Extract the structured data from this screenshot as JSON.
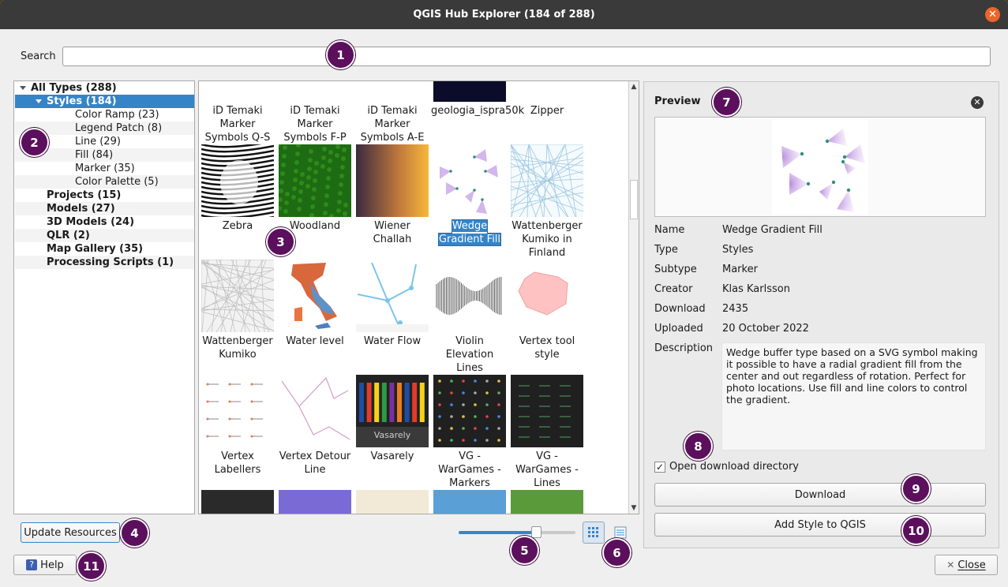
{
  "window": {
    "title": "QGIS Hub Explorer (184 of 288)",
    "close_glyph": "✕"
  },
  "search": {
    "label": "Search",
    "value": "",
    "placeholder": ""
  },
  "tree": {
    "items": [
      {
        "label": "All Types (288)",
        "level": 0,
        "bold": true,
        "expanded": true
      },
      {
        "label": "Styles (184)",
        "level": 1,
        "bold": true,
        "expanded": true,
        "selected": true
      },
      {
        "label": "Color Ramp (23)",
        "level": 2
      },
      {
        "label": "Legend Patch (8)",
        "level": 2
      },
      {
        "label": "Line (29)",
        "level": 2
      },
      {
        "label": "Fill (84)",
        "level": 2
      },
      {
        "label": "Marker (35)",
        "level": 2
      },
      {
        "label": "Color Palette (5)",
        "level": 2
      },
      {
        "label": "Projects (15)",
        "level": 1,
        "bold": true
      },
      {
        "label": "Models (27)",
        "level": 1,
        "bold": true
      },
      {
        "label": "3D Models (24)",
        "level": 1,
        "bold": true
      },
      {
        "label": "QLR (2)",
        "level": 1,
        "bold": true
      },
      {
        "label": "Map Gallery (35)",
        "level": 1,
        "bold": true
      },
      {
        "label": "Processing Scripts (1)",
        "level": 1,
        "bold": true
      }
    ]
  },
  "gallery": {
    "items": [
      {
        "label": "iD Temaki Marker Symbols Q-S",
        "thumb": "icon-grid-dark"
      },
      {
        "label": "iD Temaki Marker Symbols F-P",
        "thumb": "icon-grid-dark"
      },
      {
        "label": "iD Temaki Marker Symbols A-E",
        "thumb": "icon-grid-dark"
      },
      {
        "label": "geologia_ispra50k",
        "thumb": "navy-symbols"
      },
      {
        "label": "Zipper",
        "thumb": "zipper"
      },
      {
        "label": "Zebra",
        "thumb": "zebra"
      },
      {
        "label": "Woodland",
        "thumb": "woodland"
      },
      {
        "label": "Wiener Challah",
        "thumb": "gradient-ramp"
      },
      {
        "label": "Wedge Gradient Fill",
        "thumb": "wedges",
        "selected": true
      },
      {
        "label": "Wattenberger Kumiko in Finland",
        "thumb": "kumiko-blue"
      },
      {
        "label": "Wattenberger Kumiko",
        "thumb": "kumiko-grey"
      },
      {
        "label": "Water level",
        "thumb": "italy-map"
      },
      {
        "label": "Water Flow",
        "thumb": "water-flow"
      },
      {
        "label": "Violin Elevation Lines",
        "thumb": "australia-lines"
      },
      {
        "label": "Vertex tool style",
        "thumb": "pink-polygon"
      },
      {
        "label": "Vertex Labellers",
        "thumb": "vertex-labels"
      },
      {
        "label": "Vertex Detour Line",
        "thumb": "detour-line"
      },
      {
        "label": "Vasarely",
        "thumb": "vasarely"
      },
      {
        "label": "VG - WarGames - Markers",
        "thumb": "wargames-markers"
      },
      {
        "label": "VG - WarGames - Lines",
        "thumb": "wargames-lines"
      }
    ],
    "vasarely_overlay": "Vasarely"
  },
  "preview": {
    "title": "Preview",
    "fields": [
      {
        "label": "Name",
        "value": "Wedge Gradient Fill"
      },
      {
        "label": "Type",
        "value": "Styles"
      },
      {
        "label": "Subtype",
        "value": "Marker"
      },
      {
        "label": "Creator",
        "value": "Klas Karlsson"
      },
      {
        "label": "Download",
        "value": "2435"
      },
      {
        "label": "Uploaded",
        "value": "20 October 2022"
      }
    ],
    "description_label": "Description",
    "description": "Wedge buffer type based on a SVG symbol making it possible to have a radial gradient fill from the center and out regardless of rotation. Perfect for photo locations. Use fill and line colors to control the gradient.",
    "open_dir_label": "Open download directory",
    "open_dir_checked": true,
    "download_label": "Download",
    "add_label": "Add Style to QGIS"
  },
  "footer": {
    "update_label": "Update Resources",
    "help_label": "Help",
    "close_label": "Close",
    "zoom_level": 0.66
  },
  "callouts": [
    "1",
    "2",
    "3",
    "4",
    "5",
    "6",
    "7",
    "8",
    "9",
    "10",
    "11"
  ],
  "colors": {
    "accent": "#3584c8",
    "callout": "#5c0f5c",
    "titlebar": "#3a3a3a",
    "close": "#e9662c"
  }
}
